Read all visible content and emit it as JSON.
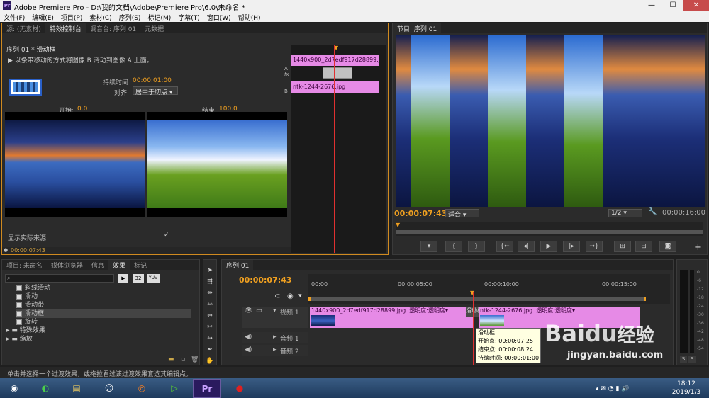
{
  "window": {
    "title": "Adobe Premiere Pro - D:\\我的文档\\Adobe\\Premiere Pro\\6.0\\未命名 *",
    "app_icon": "Pr",
    "minimize": "—",
    "maximize": "☐",
    "close": "✕"
  },
  "menu": [
    "文件(F)",
    "编辑(E)",
    "项目(P)",
    "素材(C)",
    "序列(S)",
    "标记(M)",
    "字幕(T)",
    "窗口(W)",
    "帮助(H)"
  ],
  "effect_controls": {
    "tabs": [
      "源: (无素材)",
      "特效控制台",
      "调音台: 序列 01",
      "元数据"
    ],
    "active_tab_index": 1,
    "header": "序列 01 * 滑动框",
    "description": "以条带移动的方式将图像 B 滑动到图像 A 上面。",
    "duration_label": "持续时间",
    "duration_value": "00:00:01:00",
    "align_label": "对齐:",
    "align_value": "居中于切点",
    "start_label": "开始:",
    "start_value": "0.0",
    "end_label": "结束:",
    "end_value": "100.0",
    "show_source_label": "显示实际来源",
    "timecode": "00:00:07:43",
    "mini_clip_a": "1440x900_2d7edf917d28899.jpg",
    "mini_clip_b": "ntk-1244-2676.jpg",
    "track_a": "A",
    "track_b": "B",
    "fx_label": "fx"
  },
  "program": {
    "tab": "节目: 序列 01",
    "timecode": "00:00:07:43",
    "fit": "适合",
    "resolution": "1/2",
    "duration": "00:00:16:00",
    "controls": [
      "▾",
      "{",
      "}",
      "{←",
      "◂|",
      "▶",
      "|▸",
      "→}",
      "⊞",
      "⊟",
      "◙"
    ],
    "add": "+"
  },
  "project": {
    "tabs": [
      "项目: 未命名",
      "媒体浏览器",
      "信息",
      "效果",
      "标记"
    ],
    "active_tab_index": 3,
    "search_placeholder": "",
    "badges": [
      "32",
      "YUV"
    ],
    "items": [
      {
        "label": "斜线滑动",
        "type": "effect"
      },
      {
        "label": "滑动",
        "type": "effect"
      },
      {
        "label": "滑动带",
        "type": "effect"
      },
      {
        "label": "滑动框",
        "type": "effect",
        "selected": true
      },
      {
        "label": "旋转",
        "type": "effect"
      },
      {
        "label": "特殊效果",
        "type": "folder"
      },
      {
        "label": "缩放",
        "type": "folder"
      }
    ]
  },
  "timeline": {
    "tab": "序列 01",
    "timecode": "00:00:07:43",
    "ruler": [
      "00:00",
      "00:00:05:00",
      "00:00:10:00",
      "00:00:15:00"
    ],
    "video_track": "视频 1",
    "audio_tracks": [
      "音频 1",
      "音频 2"
    ],
    "clip_a": "1440x900_2d7edf917d28899.jpg",
    "clip_a_fx": "透明度:透明度▾",
    "transition": "滑动框",
    "clip_b": "ntk-1244-2676.jpg",
    "clip_b_fx": "透明度:透明度▾",
    "tooltip": {
      "title": "滑动框",
      "start": "开始点: 00:00:07:25",
      "end": "结束点: 00:00:08:24",
      "duration": "持续时间: 00:00:01:00"
    }
  },
  "status_bar": "单击并选择一个过渡效果，或拖拉看过该过渡效果套选其编辑点。",
  "meter": {
    "labels": [
      "0",
      "-6",
      "-12",
      "-18",
      "-24",
      "-30",
      "-36",
      "-42",
      "-48",
      "-54"
    ],
    "solo": [
      "S",
      "S"
    ]
  },
  "watermark": {
    "brand": "Bai",
    "paw": "du",
    "cn": "经验",
    "url": "jingyan.baidu.com"
  },
  "taskbar": {
    "time": "18:12",
    "date": "2019/1/3",
    "apps": [
      "start-orb",
      "360-browser",
      "file-explorer",
      "qq",
      "firefox",
      "camtasia",
      "premiere",
      "recorder"
    ],
    "pr_label": "Pr"
  },
  "colors": {
    "accent": "#f0a020",
    "clip_pink": "#e68ae6",
    "playhead": "#e03030"
  }
}
